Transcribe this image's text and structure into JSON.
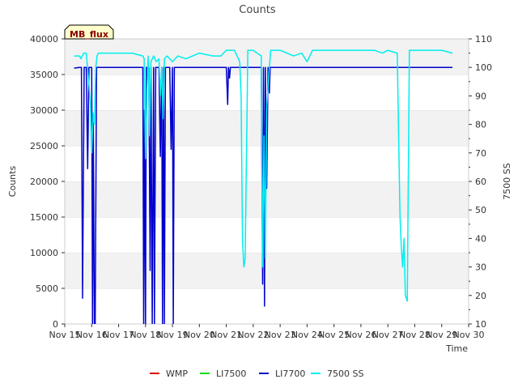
{
  "chart_data": {
    "type": "line",
    "title": "Counts",
    "xlabel": "Time",
    "ylabel_left": "Counts",
    "ylabel_right": "7500 SS",
    "ylim_left": [
      0,
      40000
    ],
    "ylim_right": [
      10,
      110
    ],
    "xlim": [
      15,
      30
    ],
    "x_unit": "day of November",
    "x_ticks": [
      15,
      16,
      17,
      18,
      19,
      20,
      21,
      22,
      23,
      24,
      25,
      26,
      27,
      28,
      29,
      30
    ],
    "x_tick_labels": [
      "Nov 15",
      "Nov 16",
      "Nov 17",
      "Nov 18",
      "Nov 19",
      "Nov 20",
      "Nov 21",
      "Nov 22",
      "Nov 23",
      "Nov 24",
      "Nov 25",
      "Nov 26",
      "Nov 27",
      "Nov 28",
      "Nov 29",
      "Nov 30"
    ],
    "y_ticks_left": [
      0,
      5000,
      10000,
      15000,
      20000,
      25000,
      30000,
      35000,
      40000
    ],
    "y_tick_labels_left": [
      "0",
      "5000",
      "10000",
      "15000",
      "20000",
      "25000",
      "30000",
      "35000",
      "40000"
    ],
    "y_ticks_right": [
      10,
      20,
      30,
      40,
      50,
      60,
      70,
      80,
      90,
      100,
      110
    ],
    "y_tick_labels_right": [
      "10",
      "20",
      "30",
      "40",
      "50",
      "60",
      "70",
      "80",
      "90",
      "100",
      "110"
    ],
    "grid": "horizontal bands",
    "legend_position": "bottom",
    "annotation": "MB_flux",
    "series": [
      {
        "name": "WMP",
        "color": "#dd0000",
        "axis": "left",
        "x": [],
        "y": []
      },
      {
        "name": "LI7500",
        "color": "#00dd00",
        "axis": "left",
        "x": [],
        "y": []
      },
      {
        "name": "LI7700",
        "color": "#0000cc",
        "axis": "left",
        "x": [
          15.35,
          15.55,
          15.62,
          15.66,
          15.72,
          15.8,
          15.85,
          15.9,
          16.0,
          16.03,
          16.06,
          16.1,
          16.13,
          16.18,
          16.22,
          16.3,
          17.9,
          17.93,
          17.96,
          18.0,
          18.03,
          18.08,
          18.12,
          18.17,
          18.2,
          18.25,
          18.3,
          18.33,
          18.38,
          18.42,
          18.5,
          18.55,
          18.6,
          18.63,
          18.67,
          18.7,
          18.74,
          18.8,
          18.9,
          18.95,
          19.0,
          19.03,
          19.07,
          19.12,
          19.2,
          19.6,
          20.0,
          21.0,
          21.05,
          21.08,
          21.12,
          21.15,
          21.3,
          22.0,
          22.3,
          22.35,
          22.38,
          22.42,
          22.45,
          22.5,
          22.55,
          22.6,
          22.63,
          22.67,
          22.7,
          23.0,
          23.5,
          24.0,
          25.0,
          26.0,
          27.0,
          27.5,
          28.0,
          28.5,
          29.0,
          29.4
        ],
        "y": [
          35900,
          36000,
          36000,
          3600,
          36000,
          36000,
          21800,
          36000,
          36000,
          0,
          28700,
          0,
          0,
          36000,
          36000,
          36000,
          36000,
          0,
          30000,
          0,
          36000,
          36000,
          36000,
          7500,
          36000,
          0,
          36000,
          0,
          36000,
          36000,
          36000,
          23500,
          36000,
          0,
          36000,
          0,
          36000,
          36000,
          36000,
          24500,
          36000,
          0,
          36000,
          36000,
          36000,
          36000,
          36000,
          36000,
          30800,
          36000,
          34500,
          36000,
          36000,
          36000,
          36000,
          5600,
          36000,
          2500,
          36000,
          19000,
          36000,
          32400,
          36000,
          36000,
          36000,
          36000,
          36000,
          36000,
          36000,
          36000,
          36000,
          36000,
          36000,
          36000,
          36000,
          36000
        ]
      },
      {
        "name": "7500 SS",
        "color": "#00eeee",
        "axis": "right",
        "x": [
          15.35,
          15.55,
          15.6,
          15.7,
          15.8,
          15.88,
          15.95,
          16.0,
          16.05,
          16.1,
          16.15,
          16.2,
          16.25,
          16.4,
          17.0,
          17.5,
          17.9,
          17.95,
          18.0,
          18.05,
          18.1,
          18.15,
          18.2,
          18.3,
          18.4,
          18.5,
          18.55,
          18.6,
          18.65,
          18.7,
          18.8,
          18.9,
          19.0,
          19.2,
          19.5,
          20.0,
          20.5,
          20.8,
          21.0,
          21.3,
          21.5,
          21.55,
          21.6,
          21.65,
          21.7,
          21.8,
          22.0,
          22.3,
          22.35,
          22.4,
          22.45,
          22.5,
          22.6,
          22.65,
          22.7,
          22.8,
          23.0,
          23.5,
          23.8,
          24.0,
          24.2,
          24.5,
          25.0,
          25.5,
          26.0,
          26.5,
          26.8,
          27.0,
          27.35,
          27.45,
          27.5,
          27.55,
          27.6,
          27.65,
          27.72,
          27.8,
          28.0,
          28.5,
          29.0,
          29.4
        ],
        "y": [
          104,
          104,
          103,
          105,
          105,
          96,
          88,
          70,
          84,
          80,
          100,
          104,
          105,
          105,
          105,
          105,
          104,
          103,
          68,
          92,
          104,
          76,
          102,
          104,
          102,
          103,
          90,
          100,
          82,
          103,
          104,
          103,
          102,
          104,
          103,
          105,
          104,
          104,
          106,
          106,
          102,
          90,
          40,
          30,
          33,
          106,
          106,
          104,
          30,
          76,
          33,
          86,
          100,
          106,
          106,
          106,
          106,
          104,
          105,
          102,
          106,
          106,
          106,
          106,
          106,
          106,
          105,
          106,
          105,
          48,
          37,
          30,
          40,
          20,
          18,
          106,
          106,
          106,
          106,
          105
        ]
      }
    ]
  }
}
